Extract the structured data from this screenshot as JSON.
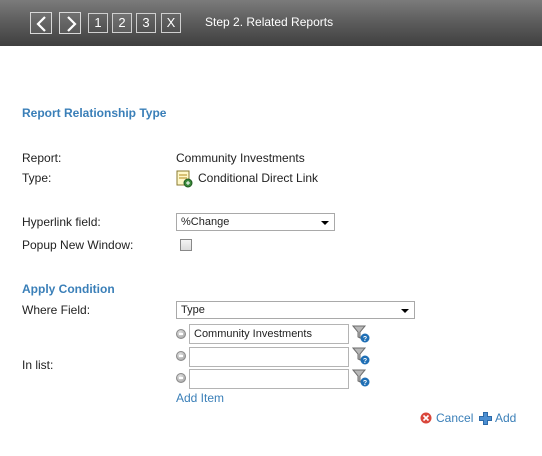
{
  "toolbar": {
    "title": "Step 2. Related Reports",
    "steps": [
      "1",
      "2",
      "3"
    ],
    "close_label": "X",
    "back_icon": "chevron-left-icon",
    "forward_icon": "chevron-right-icon"
  },
  "relationship": {
    "section_title": "Report Relationship Type",
    "report_label": "Report:",
    "report_value": "Community Investments",
    "type_label": "Type:",
    "type_value": "Conditional Direct Link",
    "hyperlink_label": "Hyperlink field:",
    "hyperlink_value": "%Change",
    "popup_label": "Popup New Window:",
    "popup_checked": false
  },
  "condition": {
    "section_title": "Apply Condition",
    "where_label": "Where Field:",
    "where_value": "Type",
    "in_list_label": "In list:",
    "list_values": [
      "Community Investments",
      "",
      ""
    ],
    "add_item_label": "Add Item"
  },
  "actions": {
    "cancel_label": "Cancel",
    "add_label": "Add"
  },
  "colors": {
    "accent": "#3a7fb8",
    "toolbar_top": "#7b7b7b",
    "toolbar_bottom": "#3f3f3f"
  }
}
